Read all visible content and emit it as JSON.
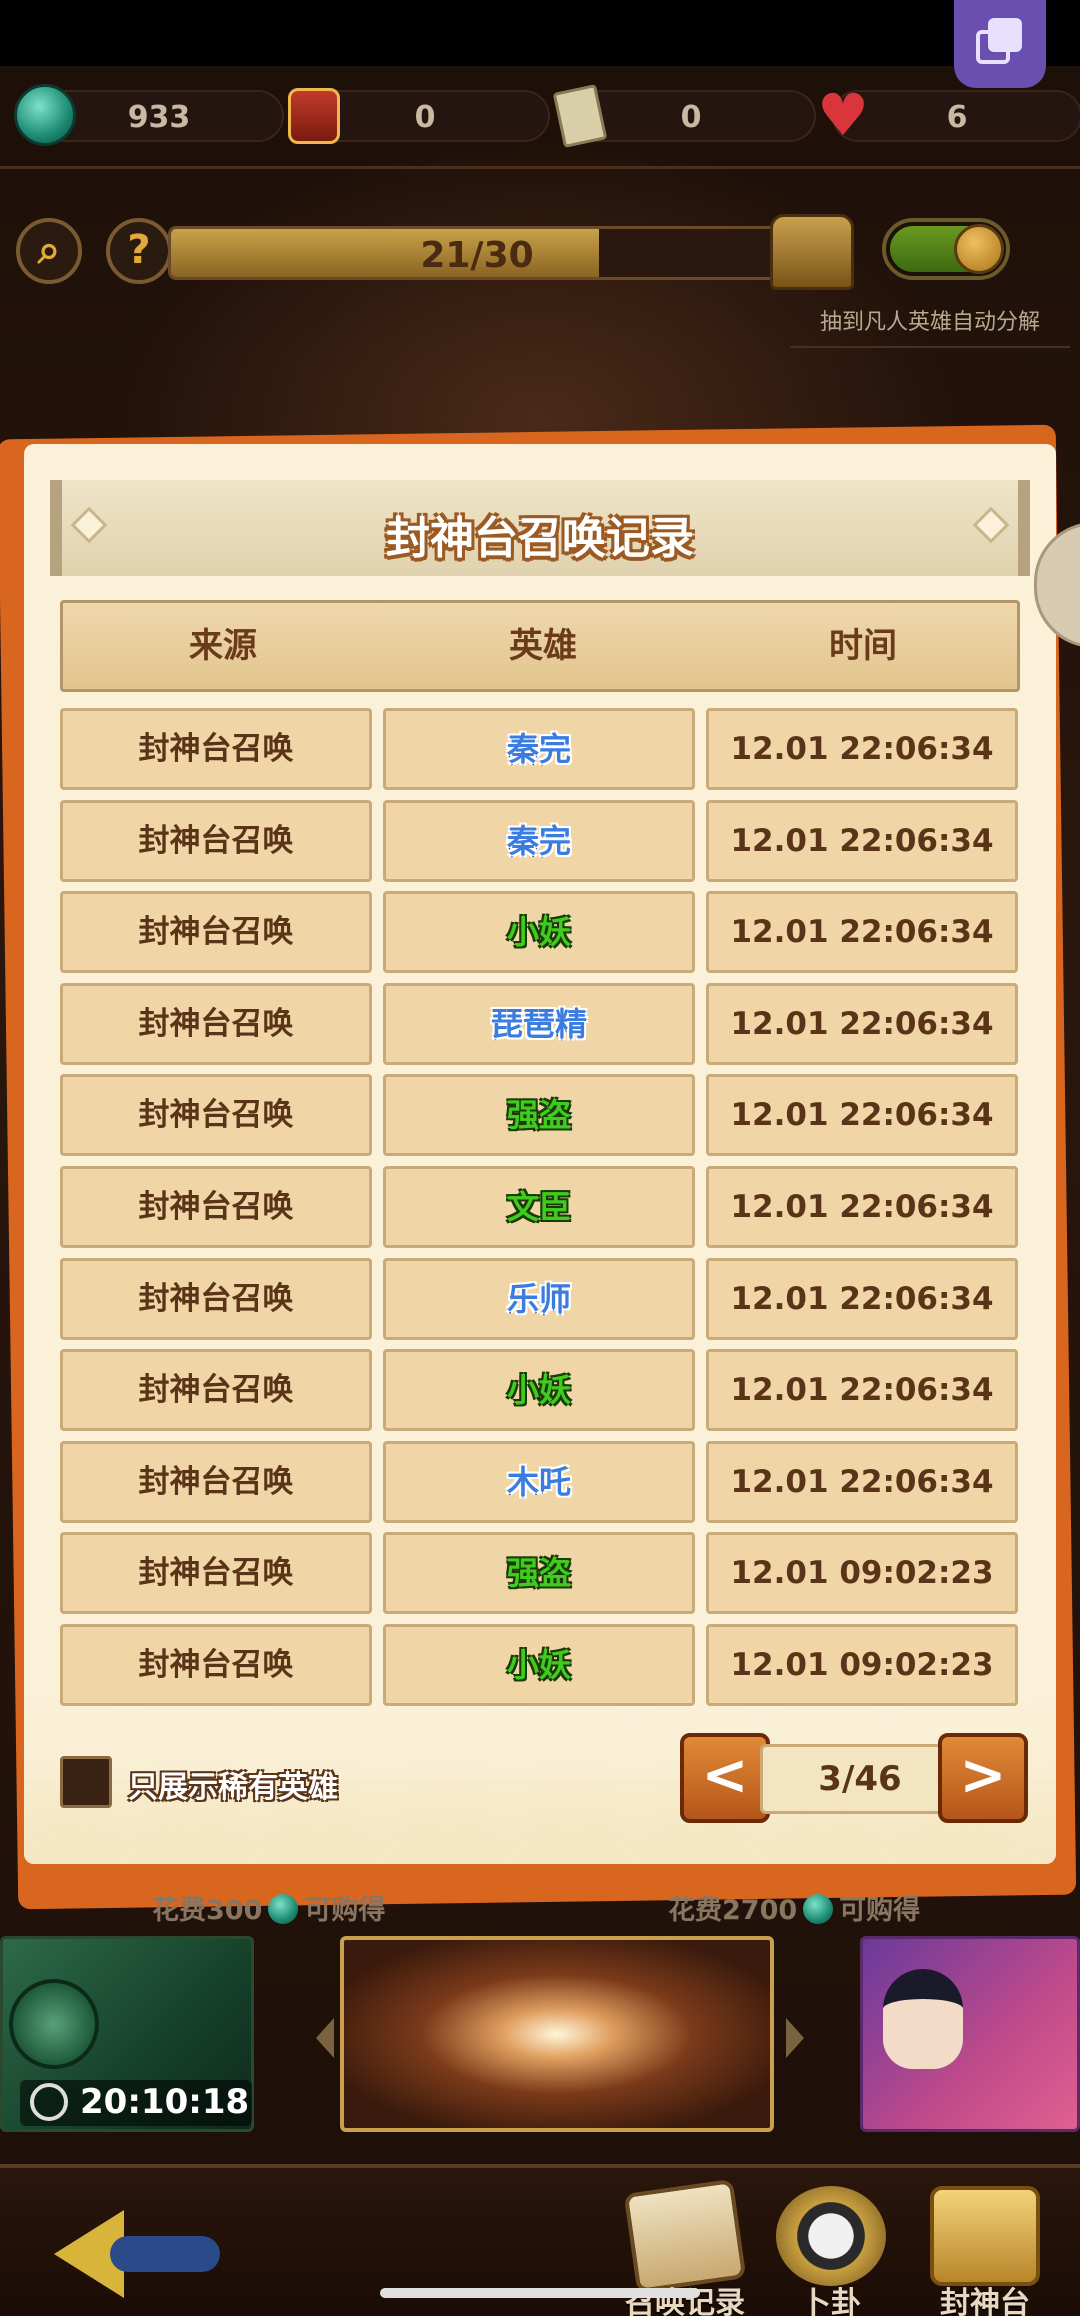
{
  "resources": {
    "jade_coin": "933",
    "gift_box": "0",
    "talisman_card": "0",
    "hearts": "6"
  },
  "summon_progress": {
    "text": "21/30",
    "fraction": 0.7
  },
  "auto_decompose": {
    "label": "抽到凡人英雄自动分解",
    "enabled": true
  },
  "modal": {
    "title": "封神台召唤记录",
    "columns": [
      "来源",
      "英雄",
      "时间"
    ],
    "rows": [
      {
        "source": "封神台召唤",
        "hero": "秦完",
        "hero_color": "blue",
        "time": "12.01 22:06:34"
      },
      {
        "source": "封神台召唤",
        "hero": "秦完",
        "hero_color": "blue",
        "time": "12.01 22:06:34"
      },
      {
        "source": "封神台召唤",
        "hero": "小妖",
        "hero_color": "green",
        "time": "12.01 22:06:34"
      },
      {
        "source": "封神台召唤",
        "hero": "琵琶精",
        "hero_color": "blue",
        "time": "12.01 22:06:34"
      },
      {
        "source": "封神台召唤",
        "hero": "强盗",
        "hero_color": "green",
        "time": "12.01 22:06:34"
      },
      {
        "source": "封神台召唤",
        "hero": "文臣",
        "hero_color": "green",
        "time": "12.01 22:06:34"
      },
      {
        "source": "封神台召唤",
        "hero": "乐师",
        "hero_color": "blue",
        "time": "12.01 22:06:34"
      },
      {
        "source": "封神台召唤",
        "hero": "小妖",
        "hero_color": "green",
        "time": "12.01 22:06:34"
      },
      {
        "source": "封神台召唤",
        "hero": "木吒",
        "hero_color": "blue",
        "time": "12.01 22:06:34"
      },
      {
        "source": "封神台召唤",
        "hero": "强盗",
        "hero_color": "green",
        "time": "12.01 09:02:23"
      },
      {
        "source": "封神台召唤",
        "hero": "小妖",
        "hero_color": "green",
        "time": "12.01 09:02:23"
      }
    ],
    "filter_label": "只展示稀有英雄",
    "filter_checked": false,
    "pager": {
      "prev": "<",
      "next": ">",
      "page_text": "3/46"
    }
  },
  "shop": {
    "left_cost": "花费300",
    "left_suffix": "可购得",
    "right_cost": "花费2700",
    "right_suffix": "可购得",
    "timer": "20:10:18"
  },
  "nav": {
    "records": "召唤记录",
    "divination": "卜卦",
    "altar": "封神台"
  },
  "colors": {
    "modal_bg": "#fbf1d9",
    "modal_border": "#d9661f",
    "hero_blue": "#3a7ce0",
    "hero_green": "#3fcc1e",
    "pager_button": "#e08a38"
  }
}
